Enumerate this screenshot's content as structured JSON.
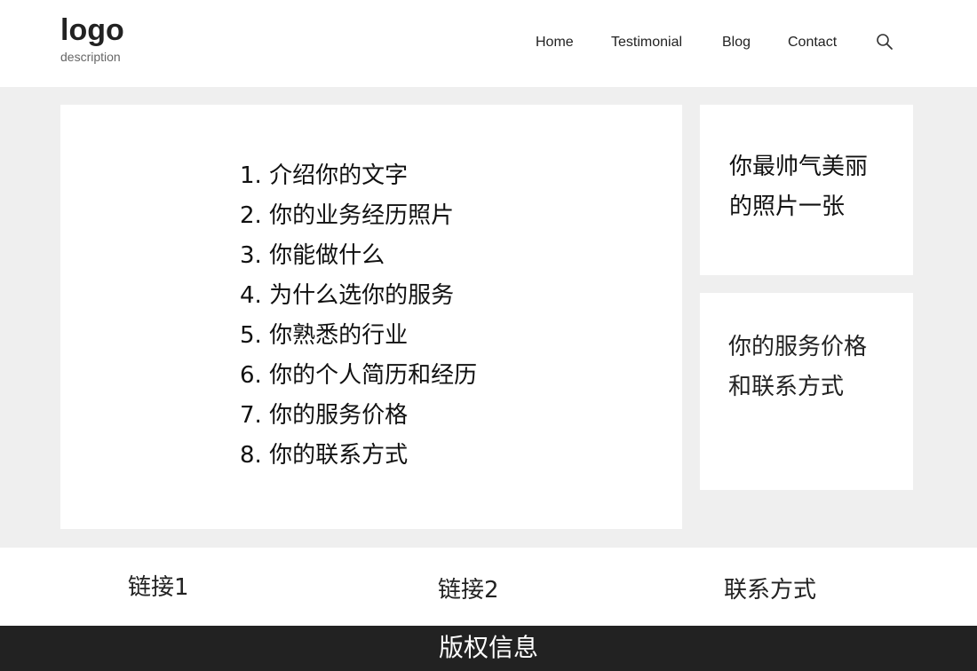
{
  "header": {
    "logo": "logo",
    "description": "description",
    "nav": [
      "Home",
      "Testimonial",
      "Blog",
      "Contact"
    ]
  },
  "main": {
    "items": [
      "1. 介绍你的文字",
      "2. 你的业务经历照片",
      "3. 你能做什么",
      "4. 为什么选你的服务",
      "5. 你熟悉的行业",
      "6. 你的个人简历和经历",
      "7. 你的服务价格",
      "8. 你的联系方式"
    ]
  },
  "sidebar": {
    "photo_text": "你最帅气美丽的照片一张",
    "price_text": "你的服务价格和联系方式"
  },
  "footer": {
    "links": [
      "链接1",
      "链接2",
      "联系方式"
    ],
    "copyright": "版权信息"
  },
  "colors": {
    "background": "#efefef",
    "panel": "#ffffff",
    "footer_bar": "#222222"
  },
  "icons": {
    "search": "search-icon"
  }
}
